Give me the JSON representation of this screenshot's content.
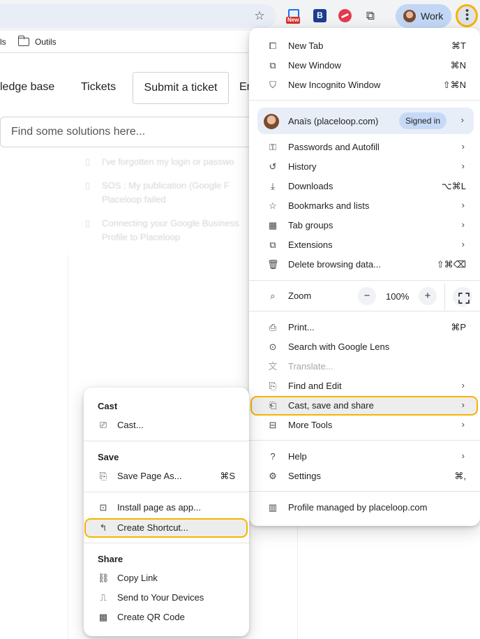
{
  "toolbar": {
    "profile_chip": "Work",
    "ext_badge": "New",
    "ext2_letter": "B"
  },
  "bookmarks_bar": {
    "partial_item": "ls",
    "folder_label": "Outils"
  },
  "page": {
    "nav": {
      "knowledge_base": "ledge base",
      "tickets": "Tickets",
      "submit_ticket": "Submit a ticket",
      "partial": "En"
    },
    "search": {
      "placeholder": "Find some solutions here..."
    },
    "faded_articles": [
      "I've forgotten my login or passwo",
      "SOS : My publication (Google F Placeloop failed",
      "Connecting your Google Business Profile to Placeloop"
    ]
  },
  "main_menu": {
    "new_tab": {
      "label": "New Tab",
      "shortcut": "⌘T"
    },
    "new_window": {
      "label": "New Window",
      "shortcut": "⌘N"
    },
    "new_incognito": {
      "label": "New Incognito Window",
      "shortcut": "⇧⌘N"
    },
    "profile": {
      "name": "Anaïs (placeloop.com)",
      "status": "Signed in"
    },
    "passwords": {
      "label": "Passwords and Autofill"
    },
    "history": {
      "label": "History"
    },
    "downloads": {
      "label": "Downloads",
      "shortcut": "⌥⌘L"
    },
    "bookmarks": {
      "label": "Bookmarks and lists"
    },
    "tab_groups": {
      "label": "Tab groups"
    },
    "extensions": {
      "label": "Extensions"
    },
    "delete_data": {
      "label": "Delete browsing data...",
      "shortcut": "⇧⌘⌫"
    },
    "zoom": {
      "label": "Zoom",
      "minus": "−",
      "value": "100%",
      "plus": "+"
    },
    "print": {
      "label": "Print...",
      "shortcut": "⌘P"
    },
    "lens": {
      "label": "Search with Google Lens"
    },
    "translate": {
      "label": "Translate..."
    },
    "find_edit": {
      "label": "Find and Edit"
    },
    "cast_save_share": {
      "label": "Cast, save and share"
    },
    "more_tools": {
      "label": "More Tools"
    },
    "help": {
      "label": "Help"
    },
    "settings": {
      "label": "Settings",
      "shortcut": "⌘,"
    },
    "managed": {
      "label": "Profile managed by placeloop.com"
    }
  },
  "sub_menu": {
    "cast_heading": "Cast",
    "cast_item": "Cast...",
    "save_heading": "Save",
    "save_page": {
      "label": "Save Page As...",
      "shortcut": "⌘S"
    },
    "install_app": "Install page as app...",
    "create_shortcut": "Create Shortcut...",
    "share_heading": "Share",
    "copy_link": "Copy Link",
    "send_devices": "Send to Your Devices",
    "qr_code": "Create QR Code"
  },
  "colors": {
    "highlight_ring": "#f5b400",
    "chip_blue": "#c2d7f6",
    "signed_in_badge": "#c6daf7"
  },
  "icons": [
    "star-icon",
    "extension-puzzle-icon",
    "kebab-icon",
    "folder-icon",
    "new-tab-icon",
    "new-window-icon",
    "incognito-icon",
    "key-icon",
    "history-icon",
    "download-icon",
    "star-icon",
    "grid-icon",
    "puzzle-icon",
    "trash-icon",
    "zoom-icon",
    "print-icon",
    "lens-icon",
    "translate-icon",
    "find-icon",
    "cast-save-icon",
    "toolbox-icon",
    "help-icon",
    "gear-icon",
    "building-icon",
    "cast-icon",
    "save-page-icon",
    "install-app-icon",
    "shortcut-icon",
    "link-icon",
    "send-devices-icon",
    "qr-icon"
  ]
}
